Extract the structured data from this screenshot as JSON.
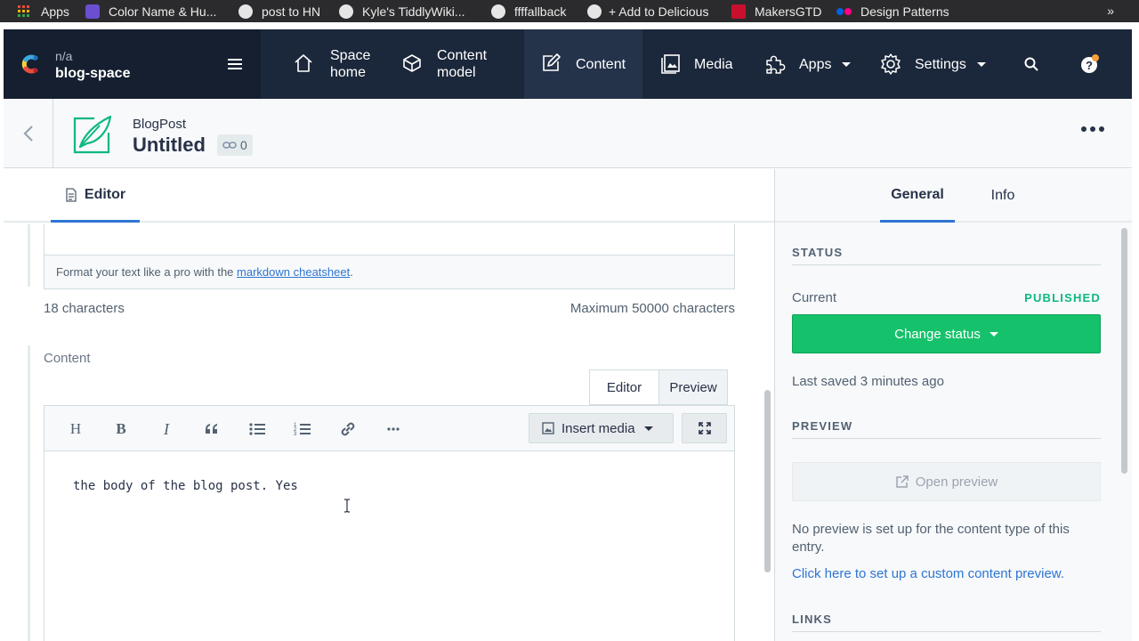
{
  "bookmarks": [
    {
      "label": "Apps",
      "color": "#e84b3c"
    },
    {
      "label": "Color Name & Hu...",
      "color": "#6b4fd1"
    },
    {
      "label": "post to HN",
      "color": "#9a9a9a"
    },
    {
      "label": "Kyle's TiddlyWiki...",
      "color": "#9a9a9a"
    },
    {
      "label": "ffffallback",
      "color": "#9a9a9a"
    },
    {
      "label": "+ Add to Delicious",
      "color": "#9a9a9a"
    },
    {
      "label": "MakersGTD",
      "color": "#c8102e"
    },
    {
      "label": "Design Patterns",
      "color": "#ff0084"
    }
  ],
  "bookmarks_more": "»",
  "space": {
    "env": "n/a",
    "name": "blog-space"
  },
  "nav": {
    "space_home": "Space home",
    "content_model": "Content model",
    "content": "Content",
    "media": "Media",
    "apps": "Apps",
    "settings": "Settings"
  },
  "entry": {
    "content_type": "BlogPost",
    "title": "Untitled",
    "references": "0"
  },
  "editor_tab": "Editor",
  "markdown_help": {
    "prefix": "Format your text like a pro with the ",
    "link": "markdown cheatsheet",
    "suffix": "."
  },
  "counts": {
    "current": "18 characters",
    "max": "Maximum 50000 characters"
  },
  "field": {
    "label": "Content",
    "mode_editor": "Editor",
    "mode_preview": "Preview",
    "insert_media": "Insert media",
    "body": "the body of the blog post. Yes"
  },
  "sidebar": {
    "tab_general": "General",
    "tab_info": "Info",
    "status_title": "STATUS",
    "current_label": "Current",
    "status_value": "PUBLISHED",
    "change_status": "Change status",
    "last_saved": "Last saved 3 minutes ago",
    "preview_title": "PREVIEW",
    "open_preview": "Open preview",
    "no_preview": "No preview is set up for the content type of this entry.",
    "setup_link": "Click here to set up a custom content preview.",
    "links_title": "LINKS"
  },
  "colors": {
    "accent": "#2e75d4",
    "published": "#0eb87f",
    "change_status_bg": "#15c26b",
    "nav_bg": "#1b273a"
  }
}
